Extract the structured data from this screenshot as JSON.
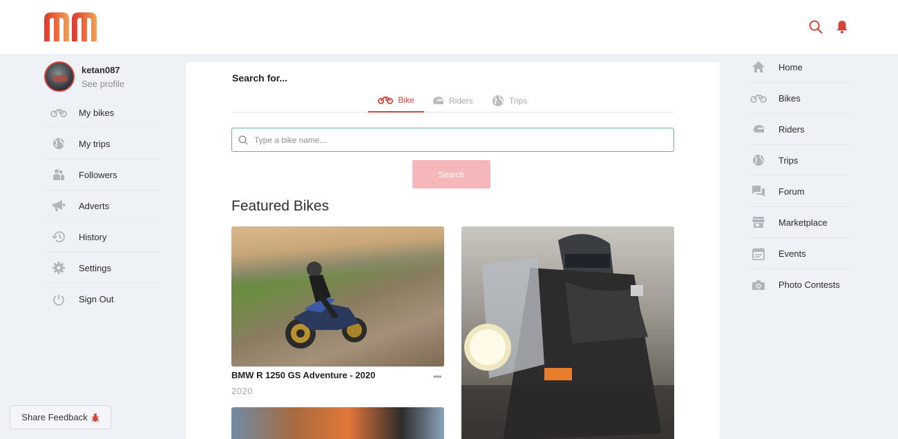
{
  "header": {
    "logo_alt": "mm",
    "search_icon": "search-icon",
    "notification_icon": "bell-icon",
    "accent_color": "#d2453b"
  },
  "profile": {
    "username": "ketan087",
    "see_profile": "See profile"
  },
  "left_nav": [
    {
      "label": "My bikes",
      "icon": "motorbike-icon"
    },
    {
      "label": "My trips",
      "icon": "globe-icon"
    },
    {
      "label": "Followers",
      "icon": "followers-icon"
    },
    {
      "label": "Adverts",
      "icon": "megaphone-icon"
    },
    {
      "label": "History",
      "icon": "history-icon"
    },
    {
      "label": "Settings",
      "icon": "gear-icon"
    },
    {
      "label": "Sign Out",
      "icon": "power-icon"
    }
  ],
  "feedback": {
    "label": "Share Feedback",
    "icon": "bug-icon"
  },
  "search": {
    "title": "Search for...",
    "tabs": [
      {
        "label": "Bike",
        "icon": "motorbike-icon",
        "active": true
      },
      {
        "label": "Riders",
        "icon": "helmet-icon",
        "active": false
      },
      {
        "label": "Trips",
        "icon": "globe-icon",
        "active": false
      }
    ],
    "placeholder": "Type a bike name...",
    "button_label": "Search"
  },
  "featured": {
    "title": "Featured Bikes",
    "cards": [
      {
        "title": "BMW R 1250 GS Adventure - 2020",
        "year": "2020",
        "more": "•••"
      }
    ]
  },
  "right_nav": [
    {
      "label": "Home",
      "icon": "home-icon"
    },
    {
      "label": "Bikes",
      "icon": "motorbike-icon"
    },
    {
      "label": "Riders",
      "icon": "helmet-icon"
    },
    {
      "label": "Trips",
      "icon": "globe-icon"
    },
    {
      "label": "Forum",
      "icon": "chat-icon"
    },
    {
      "label": "Marketplace",
      "icon": "store-icon"
    },
    {
      "label": "Events",
      "icon": "calendar-icon"
    },
    {
      "label": "Photo Contests",
      "icon": "camera-icon"
    }
  ]
}
